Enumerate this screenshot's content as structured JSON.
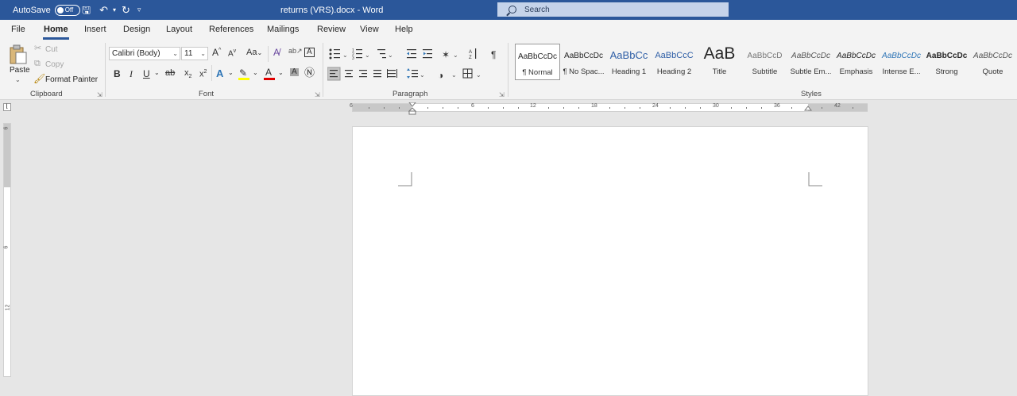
{
  "titlebar": {
    "autosave_label": "AutoSave",
    "autosave_state": "Off",
    "document_title": "returns (VRS).docx  -  Word",
    "search_placeholder": "Search"
  },
  "menu": {
    "tabs": [
      "File",
      "Home",
      "Insert",
      "Design",
      "Layout",
      "References",
      "Mailings",
      "Review",
      "View",
      "Help"
    ],
    "active_tab": "Home"
  },
  "clipboard": {
    "paste": "Paste",
    "cut": "Cut",
    "copy": "Copy",
    "format_painter": "Format Painter",
    "group_label": "Clipboard"
  },
  "font": {
    "family": "Calibri (Body)",
    "size": "11",
    "case_label": "Aa",
    "grow": "A",
    "shrink": "A",
    "bold": "B",
    "italic": "I",
    "underline": "U",
    "strike": "ab",
    "subscript": "x",
    "superscript": "x",
    "effects": "A",
    "font_color": "A",
    "shade": "A",
    "group_label": "Font"
  },
  "paragraph": {
    "group_label": "Paragraph"
  },
  "styles": {
    "group_label": "Styles",
    "items": [
      {
        "sample": "AaBbCcDc",
        "name": "¶ Normal"
      },
      {
        "sample": "AaBbCcDc",
        "name": "¶ No Spac..."
      },
      {
        "sample": "AaBbCc",
        "name": "Heading 1"
      },
      {
        "sample": "AaBbCcC",
        "name": "Heading 2"
      },
      {
        "sample": "AaB",
        "name": "Title"
      },
      {
        "sample": "AaBbCcD",
        "name": "Subtitle"
      },
      {
        "sample": "AaBbCcDc",
        "name": "Subtle Em..."
      },
      {
        "sample": "AaBbCcDc",
        "name": "Emphasis"
      },
      {
        "sample": "AaBbCcDc",
        "name": "Intense E..."
      },
      {
        "sample": "AaBbCcDc",
        "name": "Strong"
      },
      {
        "sample": "AaBbCcDc",
        "name": "Quote"
      }
    ]
  },
  "ruler": {
    "h_numbers": [
      "6",
      "6",
      "12",
      "18",
      "24",
      "30",
      "36",
      "42"
    ],
    "v_numbers": [
      "6",
      "6",
      "12"
    ]
  },
  "colors": {
    "title_bar": "#2b579a",
    "ribbon": "#f3f3f3",
    "workspace": "#e6e6e6",
    "page": "#ffffff",
    "highlight": "#ffff00",
    "font_color": "#e00000"
  }
}
